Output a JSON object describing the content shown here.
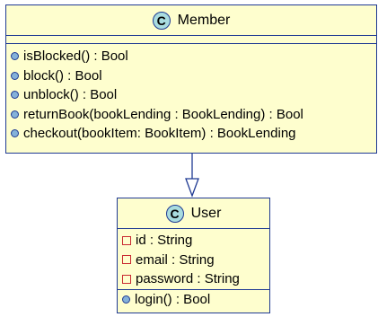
{
  "member_class": {
    "stereotype": "C",
    "name": "Member",
    "methods": [
      "isBlocked() : Bool",
      "block() : Bool",
      "unblock() : Bool",
      "returnBook(bookLending : BookLending) : Bool",
      "checkout(bookItem: BookItem) : BookLending"
    ]
  },
  "user_class": {
    "stereotype": "C",
    "name": "User",
    "fields": [
      "id : String",
      "email : String",
      "password : String"
    ],
    "methods": [
      "login() : Bool"
    ]
  },
  "relationship": {
    "type": "inheritance",
    "from": "Member",
    "to": "User"
  },
  "colors": {
    "class_fill": "#fefece",
    "border": "#1f3a93",
    "stereotype_fill": "#a9dcdf",
    "public_method": "#84b1d9",
    "private_field": "#c82930"
  }
}
